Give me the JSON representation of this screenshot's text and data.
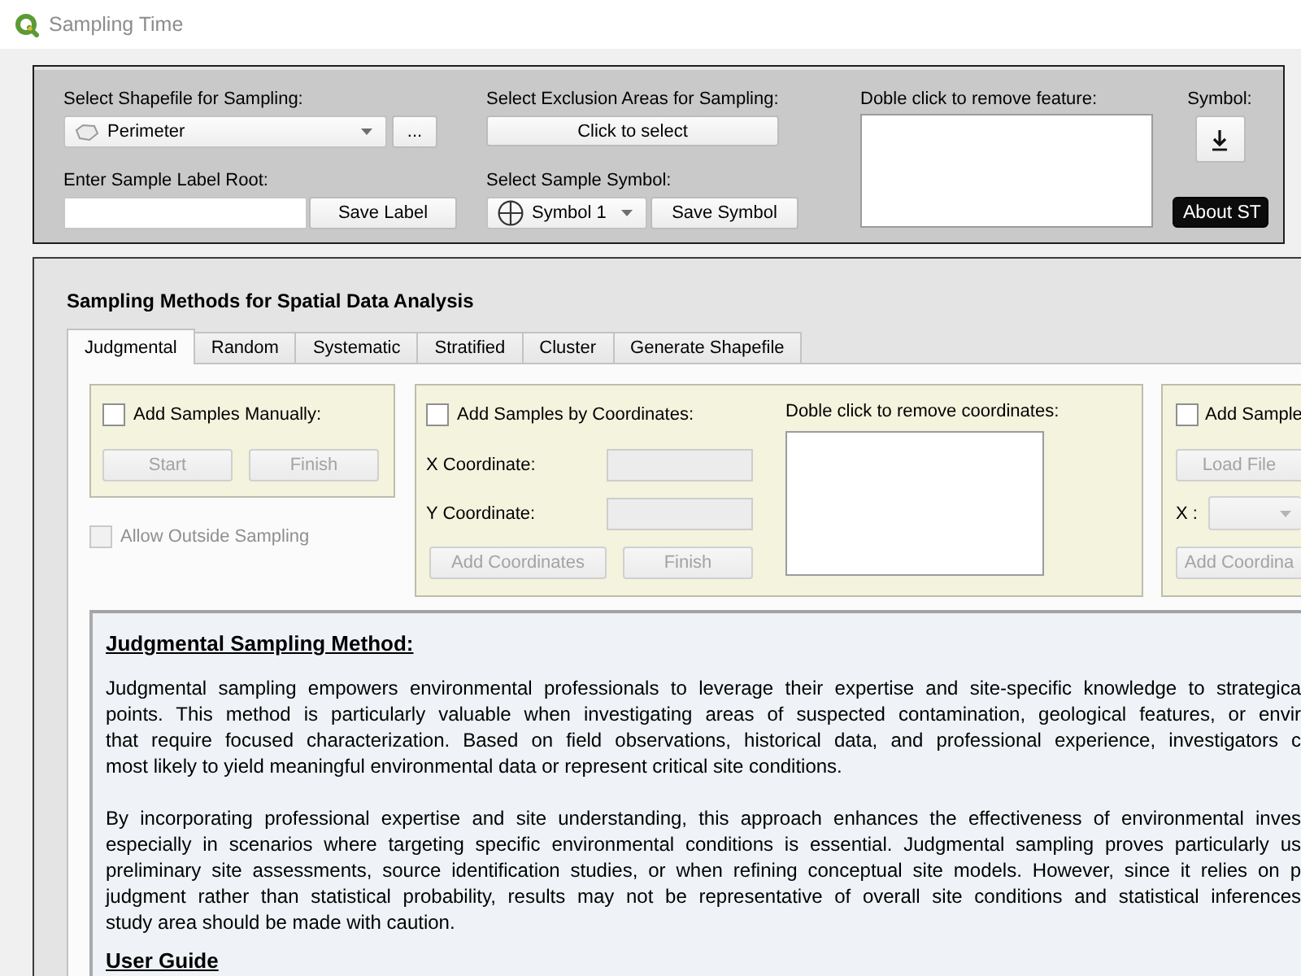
{
  "window": {
    "title": "Sampling Time"
  },
  "top_panel": {
    "shapefile": {
      "label": "Select Shapefile for Sampling:",
      "value": "Perimeter",
      "browse_button": "..."
    },
    "label_root": {
      "label": "Enter Sample Label Root:",
      "save_button": "Save Label"
    },
    "exclusion": {
      "label": "Select Exclusion Areas for Sampling:",
      "button": "Click to select"
    },
    "sample_symbol": {
      "label": "Select Sample Symbol:",
      "value": "Symbol 1",
      "save_button": "Save Symbol"
    },
    "feature_list": {
      "label": "Doble click to remove feature:"
    },
    "symbol": {
      "label": "Symbol:"
    },
    "about_button": "About ST"
  },
  "methods": {
    "title": "Sampling Methods for Spatial Data Analysis",
    "tabs": [
      {
        "label": "Judgmental",
        "selected": true
      },
      {
        "label": "Random",
        "selected": false
      },
      {
        "label": "Systematic",
        "selected": false
      },
      {
        "label": "Stratified",
        "selected": false
      },
      {
        "label": "Cluster",
        "selected": false
      },
      {
        "label": "Generate Shapefile",
        "selected": false
      }
    ],
    "manual_group": {
      "checkbox": {
        "label": "Add Samples Manually:",
        "checked": false
      },
      "buttons": [
        {
          "label": "Start",
          "disabled": true
        },
        {
          "label": "Finish",
          "disabled": true
        }
      ]
    },
    "allow_outside": {
      "label": "Allow Outside Sampling",
      "checked": false,
      "disabled": true
    },
    "coordinates_group": {
      "checkbox": {
        "label": "Add Samples by Coordinates:",
        "checked": false
      },
      "fields": [
        {
          "label": "X Coordinate:",
          "disabled": true
        },
        {
          "label": "Y Coordinate:",
          "disabled": true
        }
      ],
      "buttons": [
        {
          "label": "Add Coordinates",
          "disabled": true
        },
        {
          "label": "Finish",
          "disabled": true
        }
      ],
      "list_label": "Doble click to remove coordinates:"
    },
    "file_group": {
      "checkbox": {
        "label": "Add Sample",
        "checked": false
      },
      "load_button": {
        "label": "Load File",
        "disabled": true
      },
      "x_label": "X :",
      "x_combo": {
        "disabled": true
      },
      "add_button": {
        "label": "Add Coordina",
        "disabled": true
      }
    },
    "description": {
      "heading": "Judgmental Sampling Method:",
      "paragraphs": [
        {
          "lines": [
            "Judgmental sampling empowers environmental professionals to leverage their expertise and site-specific knowledge to strategica",
            "points. This method is particularly valuable when investigating areas of suspected contamination, geological features, or envir",
            "that require focused characterization. Based on field observations, historical data, and professional experience, investigators c",
            "most likely to yield meaningful environmental data or represent critical site conditions."
          ]
        },
        {
          "lines": [
            "By incorporating professional expertise and site understanding, this approach enhances the effectiveness of environmental inves",
            "especially in scenarios where targeting specific environmental conditions is essential. Judgmental sampling proves particularly us",
            "preliminary site assessments, source identification studies, or when refining conceptual site models. However, since it relies on p",
            "judgment rather than statistical probability, results may not be representative of overall site conditions and statistical inferences",
            "study area should be made with caution."
          ]
        }
      ],
      "subheading": "User Guide"
    }
  }
}
